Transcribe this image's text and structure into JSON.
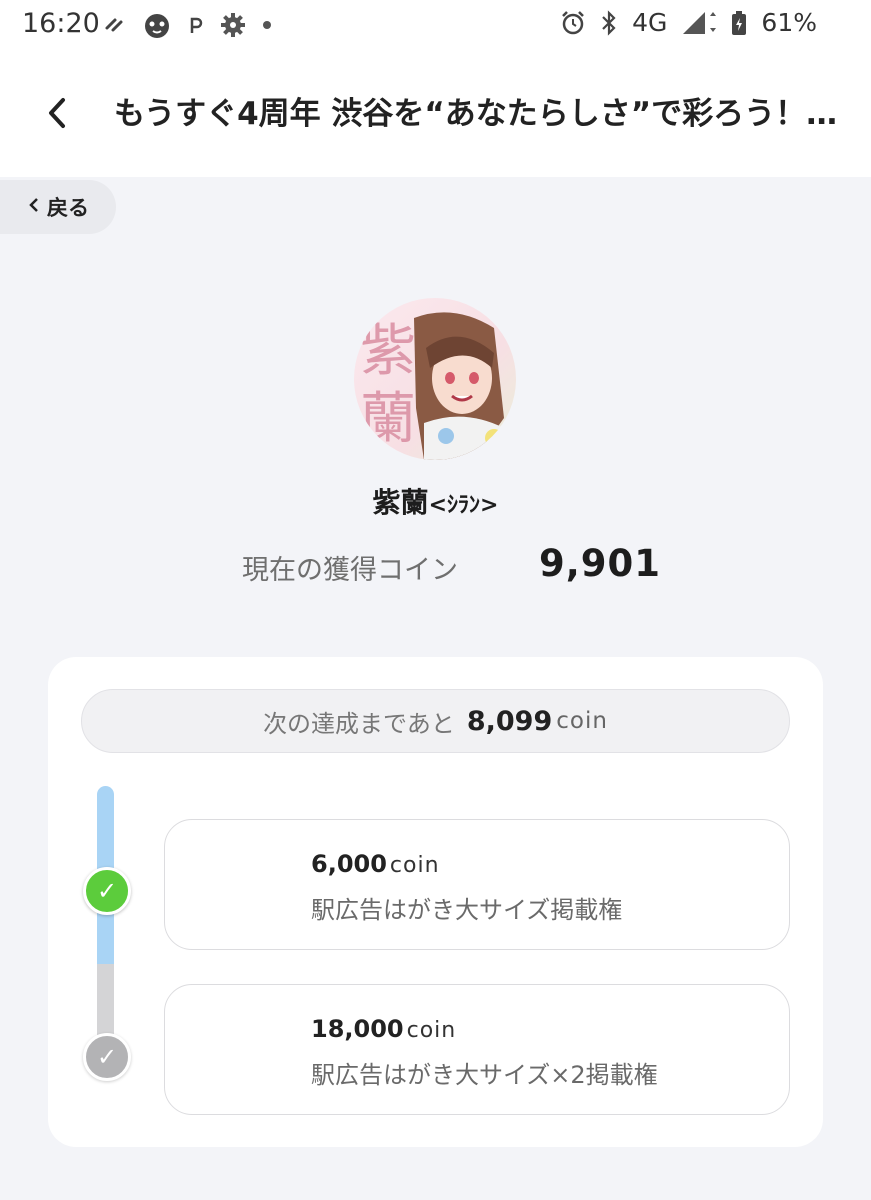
{
  "status_bar": {
    "time": "16:20",
    "left_icons": [
      "hatena-icon",
      "cat-face-icon",
      "pixiv-icon",
      "gear-icon",
      "dot-icon"
    ],
    "network": "4G",
    "battery": "61%"
  },
  "app_bar": {
    "title": "もうすぐ4周年 渋谷を“あなたらしさ”で彩ろう！…"
  },
  "back_button": {
    "label": "戻る"
  },
  "artist": {
    "name": "紫蘭",
    "name_suffix": "<ｼﾗﾝ>",
    "avatar_text": "紫蘭"
  },
  "coins": {
    "label": "現在の獲得コイン",
    "value": "9,901"
  },
  "next_goal": {
    "prefix": "次の達成まであと",
    "amount": "8,099",
    "unit": "coin"
  },
  "milestones": [
    {
      "amount": "6,000",
      "unit": "coin",
      "reward": "駅広告はがき大サイズ掲載権",
      "achieved": true
    },
    {
      "amount": "18,000",
      "unit": "coin",
      "reward": "駅広告はがき大サイズ×2掲載権",
      "achieved": false
    }
  ],
  "colors": {
    "background": "#f3f4f8",
    "progress_fill": "#a9d4f5",
    "achieved_check": "#5ccc3c",
    "pending_check": "#b3b3b5"
  },
  "progress_fraction": 0.55
}
